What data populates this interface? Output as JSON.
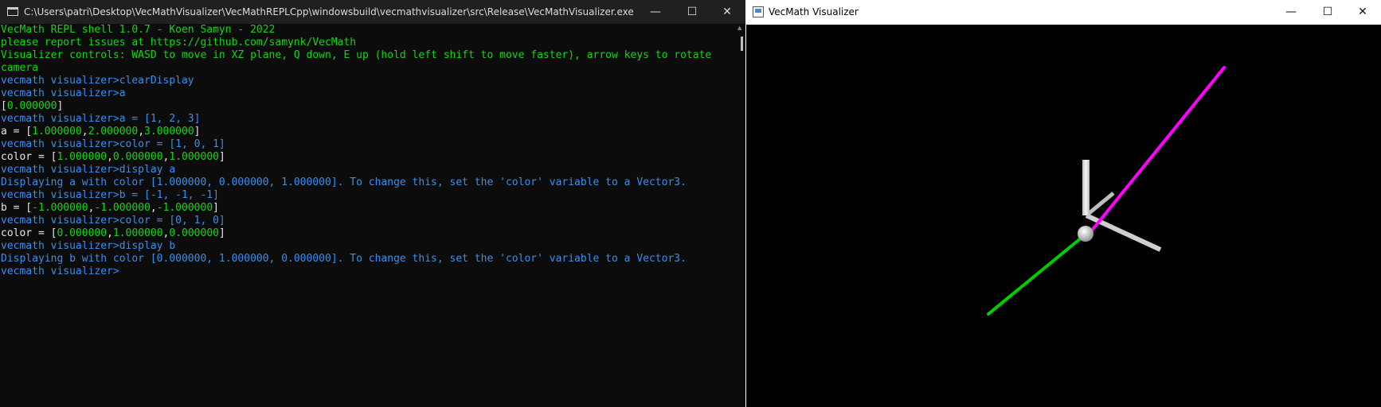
{
  "console": {
    "title": "C:\\Users\\patri\\Desktop\\VecMathVisualizer\\VecMathREPLCpp\\windowsbuild\\vecmathvisualizer\\src\\Release\\VecMathVisualizer.exe",
    "controls": {
      "minimize": "—",
      "maximize": "☐",
      "close": "✕"
    },
    "lines": [
      {
        "parts": [
          {
            "text": "VecMath REPL shell 1.0.7 - Koen Samyn - 2022",
            "color": "green"
          }
        ]
      },
      {
        "parts": [
          {
            "text": "please report issues at https://github.com/samynk/VecMath",
            "color": "green"
          }
        ]
      },
      {
        "wrap": true,
        "parts": [
          {
            "text": "Visualizer controls: WASD to move in XZ plane, Q down, E up (hold left shift to move faster), arrow keys to rotate camera",
            "color": "green"
          }
        ]
      },
      {
        "parts": [
          {
            "text": "vecmath visualizer>clearDisplay",
            "color": "blue"
          }
        ]
      },
      {
        "parts": [
          {
            "text": "vecmath visualizer>a",
            "color": "blue"
          }
        ]
      },
      {
        "parts": [
          {
            "text": "[",
            "color": "white"
          },
          {
            "text": "0.000000",
            "color": "green"
          },
          {
            "text": "]",
            "color": "white"
          }
        ]
      },
      {
        "parts": [
          {
            "text": "vecmath visualizer>a = [1, 2, 3]",
            "color": "blue"
          }
        ]
      },
      {
        "parts": [
          {
            "text": "a = [",
            "color": "white"
          },
          {
            "text": "1.000000",
            "color": "green"
          },
          {
            "text": ",",
            "color": "white"
          },
          {
            "text": "2.000000",
            "color": "green"
          },
          {
            "text": ",",
            "color": "white"
          },
          {
            "text": "3.000000",
            "color": "green"
          },
          {
            "text": "]",
            "color": "white"
          }
        ]
      },
      {
        "parts": [
          {
            "text": "vecmath visualizer>color = [1, 0, 1]",
            "color": "blue"
          }
        ]
      },
      {
        "parts": [
          {
            "text": "color = [",
            "color": "white"
          },
          {
            "text": "1.000000",
            "color": "green"
          },
          {
            "text": ",",
            "color": "white"
          },
          {
            "text": "0.000000",
            "color": "green"
          },
          {
            "text": ",",
            "color": "white"
          },
          {
            "text": "1.000000",
            "color": "green"
          },
          {
            "text": "]",
            "color": "white"
          }
        ]
      },
      {
        "parts": [
          {
            "text": "vecmath visualizer>display a",
            "color": "blue"
          }
        ]
      },
      {
        "parts": [
          {
            "text": "Displaying a with color [1.000000, 0.000000, 1.000000]. To change this, set the 'color' variable to a Vector3.",
            "color": "blue"
          }
        ]
      },
      {
        "parts": [
          {
            "text": "vecmath visualizer>b = [-1, -1, -1]",
            "color": "blue"
          }
        ]
      },
      {
        "parts": [
          {
            "text": "b = [",
            "color": "white"
          },
          {
            "text": "-1.000000",
            "color": "green"
          },
          {
            "text": ",",
            "color": "white"
          },
          {
            "text": "-1.000000",
            "color": "green"
          },
          {
            "text": ",",
            "color": "white"
          },
          {
            "text": "-1.000000",
            "color": "green"
          },
          {
            "text": "]",
            "color": "white"
          }
        ]
      },
      {
        "parts": [
          {
            "text": "vecmath visualizer>color = [0, 1, 0]",
            "color": "blue"
          }
        ]
      },
      {
        "parts": [
          {
            "text": "color = [",
            "color": "white"
          },
          {
            "text": "0.000000",
            "color": "green"
          },
          {
            "text": ",",
            "color": "white"
          },
          {
            "text": "1.000000",
            "color": "green"
          },
          {
            "text": ",",
            "color": "white"
          },
          {
            "text": "0.000000",
            "color": "green"
          },
          {
            "text": "]",
            "color": "white"
          }
        ]
      },
      {
        "parts": [
          {
            "text": "vecmath visualizer>display b",
            "color": "blue"
          }
        ]
      },
      {
        "parts": [
          {
            "text": "Displaying b with color [0.000000, 1.000000, 0.000000]. To change this, set the 'color' variable to a Vector3.",
            "color": "blue"
          }
        ]
      },
      {
        "parts": [
          {
            "text": "vecmath visualizer>",
            "color": "blue"
          }
        ]
      }
    ]
  },
  "visualizer": {
    "title": "VecMath Visualizer",
    "controls": {
      "minimize": "—",
      "maximize": "☐",
      "close": "✕"
    },
    "vectors": [
      {
        "name": "a",
        "color": "#ff00ff"
      },
      {
        "name": "b",
        "color": "#00cc00"
      }
    ],
    "axis_color": "#d8d8d8",
    "background": "#000000"
  }
}
